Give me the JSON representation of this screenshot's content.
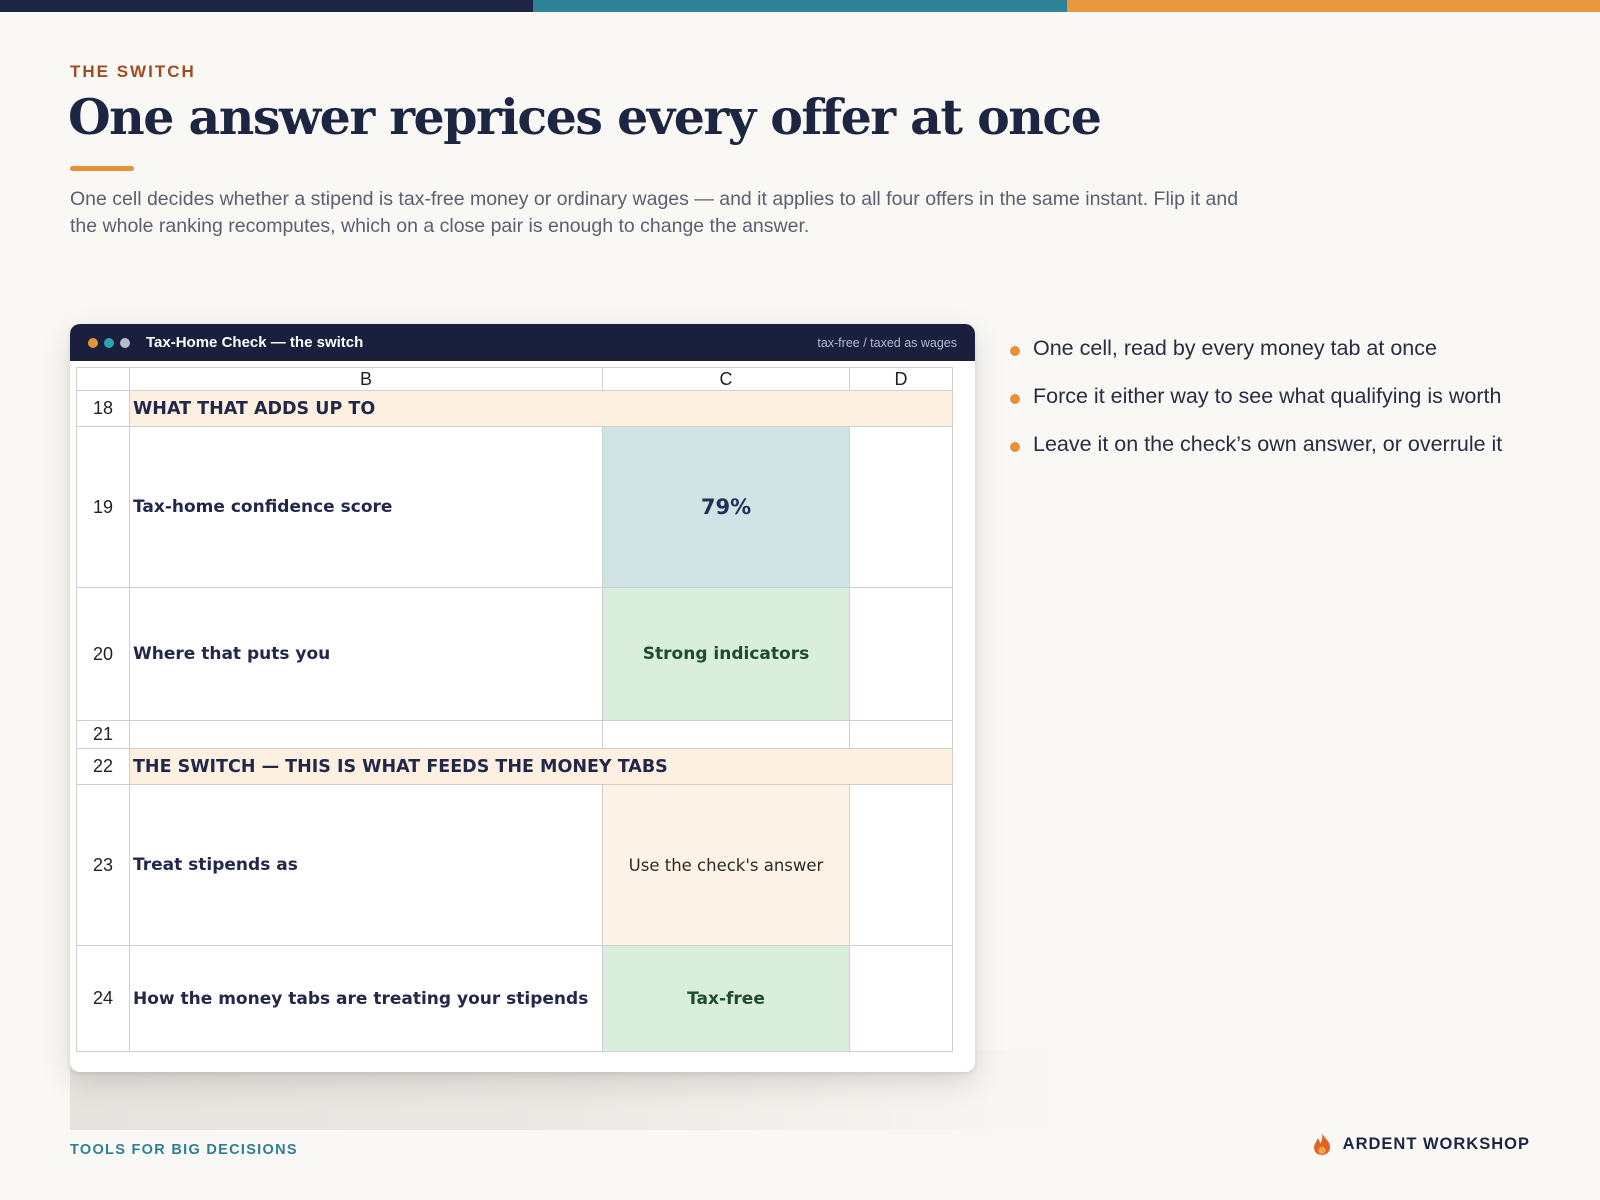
{
  "colors": {
    "navy": "#1c2541",
    "teal": "#2f7f94",
    "orange": "#e8913a",
    "rust": "#a44a22"
  },
  "slide": {
    "eyebrow": "THE SWITCH",
    "title": "One answer reprices every offer at once",
    "lede": "One cell decides whether a stipend is tax-free money or ordinary wages — and it applies to all four offers in the same instant. Flip it and the whole ranking recomputes, which on a close pair is enough to change the answer."
  },
  "window": {
    "title": "Tax-Home Check — the switch",
    "subtitle": "tax-free / taxed as wages",
    "dots": [
      "#e8913a",
      "#2ea3b0",
      "#b7bcc9"
    ]
  },
  "sheet": {
    "columns": [
      "",
      "B",
      "C",
      "D"
    ],
    "rows": [
      {
        "num": "18",
        "kind": "section",
        "label": "WHAT THAT ADDS UP TO"
      },
      {
        "num": "19",
        "kind": "value",
        "label": "Tax-home confidence score",
        "value": "79%",
        "style": "blue"
      },
      {
        "num": "20",
        "kind": "value",
        "label": "Where that puts you",
        "value": "Strong indicators",
        "style": "green"
      },
      {
        "num": "21",
        "kind": "blank"
      },
      {
        "num": "22",
        "kind": "section",
        "label": "THE SWITCH — THIS IS WHAT FEEDS THE MONEY TABS"
      },
      {
        "num": "23",
        "kind": "value",
        "label": "Treat stipends as",
        "value": "Use the check's answer",
        "style": "cream",
        "interactive": true
      },
      {
        "num": "24",
        "kind": "value",
        "label": "How the money tabs are treating your stipends",
        "value": "Tax-free",
        "style": "green"
      }
    ]
  },
  "bullets": [
    "One cell, read by every money tab at once",
    "Force it either way to see what qualifying is worth",
    "Leave it on the check’s own answer, or overrule it"
  ],
  "footer": {
    "left": "TOOLS FOR BIG DECISIONS",
    "brand": "ARDENT WORKSHOP",
    "brand_icon": "flame-icon"
  }
}
